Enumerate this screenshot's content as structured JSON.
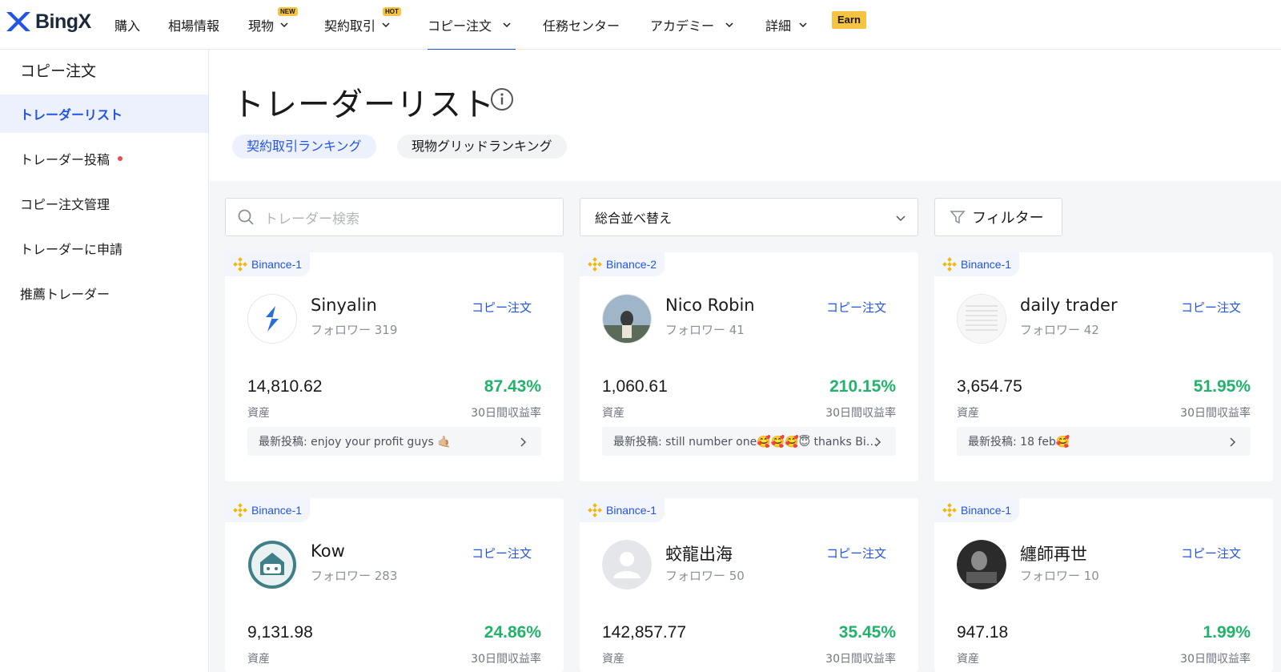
{
  "brand": {
    "name": "BingX",
    "accent": "#2354e6",
    "logo_blue": "#2354e6"
  },
  "nav": {
    "items": [
      {
        "label": "購入"
      },
      {
        "label": "相場情報"
      },
      {
        "label": "現物",
        "badge": "NEW"
      },
      {
        "label": "契約取引",
        "badge": "HOT"
      },
      {
        "label": "コピー注文"
      },
      {
        "label": "任務センター"
      },
      {
        "label": "アカデミー"
      },
      {
        "label": "詳細"
      }
    ],
    "earn": "Earn"
  },
  "sidebar": {
    "title": "コピー注文",
    "items": [
      {
        "label": "トレーダーリスト"
      },
      {
        "label": "トレーダー投稿"
      },
      {
        "label": "コピー注文管理"
      },
      {
        "label": "トレーダーに申請"
      },
      {
        "label": "推薦トレーダー"
      }
    ]
  },
  "main": {
    "title": "トレーダーリスト",
    "tabs": [
      {
        "label": "契約取引ランキング"
      },
      {
        "label": "現物グリッドランキング"
      }
    ],
    "search": {
      "placeholder": "トレーダー検索"
    },
    "sort": {
      "value": "総合並べ替え"
    },
    "filter_label": "フィルター"
  },
  "cards": [
    {
      "tag": "Binance-1",
      "name": "Sinyalin",
      "followers": "フォロワー 319",
      "copy_label": "コピー注文",
      "asset": "14,810.62",
      "asset_label": "資産",
      "roi": "87.43%",
      "roi_label": "30日間収益率",
      "post": "最新投稿: enjoy your profit guys 🤙🏼"
    },
    {
      "tag": "Binance-2",
      "name": "Nico Robin",
      "followers": "フォロワー 41",
      "copy_label": "コピー注文",
      "asset": "1,060.61",
      "asset_label": "資産",
      "roi": "210.15%",
      "roi_label": "30日間収益率",
      "post": "最新投稿: still number one🥰🥰🥰😇 thanks Bi…"
    },
    {
      "tag": "Binance-1",
      "name": "daily trader",
      "followers": "フォロワー 42",
      "copy_label": "コピー注文",
      "asset": "3,654.75",
      "asset_label": "資産",
      "roi": "51.95%",
      "roi_label": "30日間収益率",
      "post": "最新投稿: 18 feb🥰"
    },
    {
      "tag": "Binance-1",
      "name": "Kow",
      "followers": "フォロワー 283",
      "copy_label": "コピー注文",
      "asset": "9,131.98",
      "asset_label": "資産",
      "roi": "24.86%",
      "roi_label": "30日間収益率"
    },
    {
      "tag": "Binance-1",
      "name": "蛟龍出海",
      "followers": "フォロワー 50",
      "copy_label": "コピー注文",
      "asset": "142,857.77",
      "asset_label": "資産",
      "roi": "35.45%",
      "roi_label": "30日間収益率"
    },
    {
      "tag": "Binance-1",
      "name": "纏師再世",
      "followers": "フォロワー 10",
      "copy_label": "コピー注文",
      "asset": "947.18",
      "asset_label": "資産",
      "roi": "1.99%",
      "roi_label": "30日間収益率"
    }
  ]
}
